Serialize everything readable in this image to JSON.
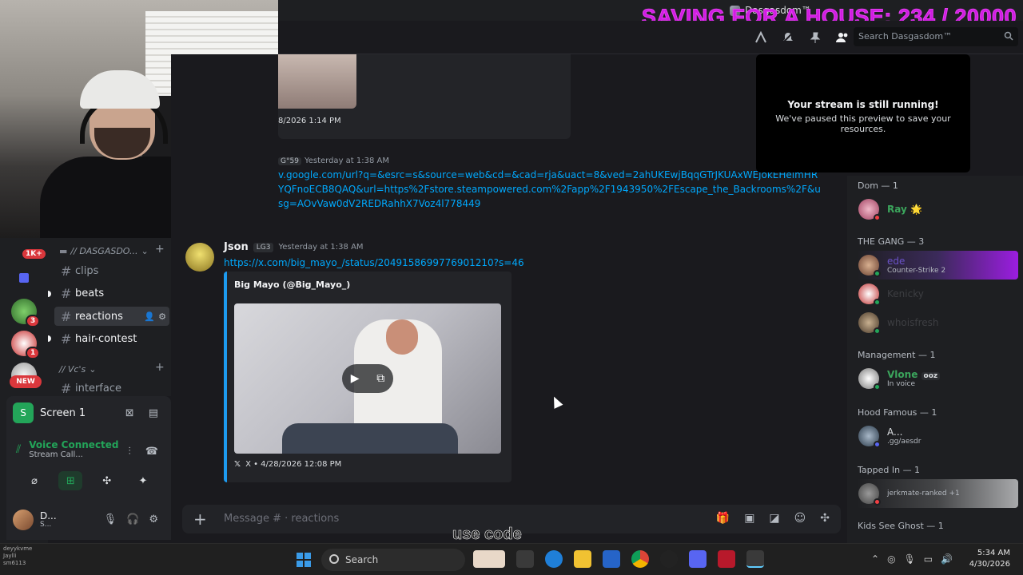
{
  "window": {
    "title": "Dasgasdom™"
  },
  "overlay": {
    "banner": "SAVING FOR A HOUSE: 234 / 20000",
    "bottom_text": "use code"
  },
  "header": {
    "search_placeholder": "Search Dasgasdom™"
  },
  "server_rail": {
    "badges": [
      "1K+",
      "3",
      "1"
    ],
    "new_label": "NEW"
  },
  "channels": {
    "category1": "// DASGASDO...",
    "items": [
      {
        "name": "clips"
      },
      {
        "name": "beats"
      },
      {
        "name": "reactions"
      },
      {
        "name": "hair-contest"
      }
    ],
    "category2": "// Vc's",
    "voice_items": [
      {
        "name": "interface"
      }
    ]
  },
  "panel": {
    "screen_label": "Screen 1",
    "voice_title": "Voice Connected",
    "voice_sub": "Stream Call...",
    "user_name": "D...",
    "user_status": "S..."
  },
  "messages": {
    "top_embed_time": "8/2026 1:14 PM",
    "msg1": {
      "author": "G°59",
      "time": "Yesterday at 1:38 AM",
      "link": "v.google.com/url?q=&esrc=s&source=web&cd=&cad=rja&uact=8&ved=2ahUKEwjBqqGTrJKUAxWEjokEHelmHRYQFnoECB8QAQ&url=https%2Fstore.steampowered.com%2Fapp%2F1943950%2FEscape_the_Backrooms%2F&usg=AOvVaw0dV2REDRahhX7Voz4l778449"
    },
    "msg2": {
      "author": "Json",
      "tag": "LG3",
      "time": "Yesterday at 1:38 AM",
      "link": "https://x.com/big_mayo_/status/2049158699776901210?s=46",
      "embed_title": "Big Mayo (@Big_Mayo_)",
      "embed_footer": "X • 4/28/2026 12:08 PM"
    }
  },
  "composer": {
    "placeholder": "Message # · reactions"
  },
  "stream_preview": {
    "title": "Your stream is still running!",
    "subtitle": "We've paused this preview to save your resources."
  },
  "members": {
    "groups": [
      {
        "label": "Dom — 1",
        "members": [
          {
            "name": "Ray 🌟",
            "activity": ""
          }
        ]
      },
      {
        "label": "THE GANG — 3",
        "members": [
          {
            "name": "ede",
            "activity": "Counter-Strike 2"
          },
          {
            "name": "Kenicky",
            "activity": ""
          },
          {
            "name": "whoisfresh",
            "activity": ""
          }
        ]
      },
      {
        "label": "Management — 1",
        "members": [
          {
            "name": "Vlone",
            "activity": "In voice",
            "tag": "ooz"
          }
        ]
      },
      {
        "label": "Hood Famous — 1",
        "members": [
          {
            "name": "A...",
            "activity": ".gg/aesdr"
          }
        ]
      },
      {
        "label": "Tapped In — 1",
        "members": [
          {
            "name": "",
            "activity": "jerkmate-ranked +1"
          }
        ]
      },
      {
        "label": "Kids See Ghost — 1",
        "members": []
      }
    ]
  },
  "taskbar": {
    "search_label": "Search",
    "time": "5:34 AM",
    "date": "4/30/2026",
    "mini_users": [
      "deyykvme",
      "Jaylli",
      "sm6113"
    ]
  },
  "colors": {
    "accent": "#5865f2",
    "link": "#00a8fc",
    "online": "#23a559",
    "banner": "#d01ce2"
  }
}
